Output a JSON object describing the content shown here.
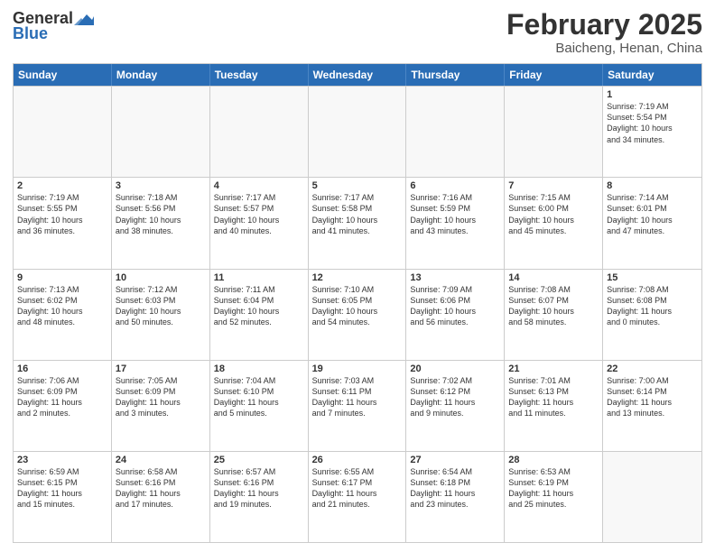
{
  "header": {
    "logo_general": "General",
    "logo_blue": "Blue",
    "month": "February 2025",
    "location": "Baicheng, Henan, China"
  },
  "days_of_week": [
    "Sunday",
    "Monday",
    "Tuesday",
    "Wednesday",
    "Thursday",
    "Friday",
    "Saturday"
  ],
  "weeks": [
    [
      {
        "day": "",
        "info": ""
      },
      {
        "day": "",
        "info": ""
      },
      {
        "day": "",
        "info": ""
      },
      {
        "day": "",
        "info": ""
      },
      {
        "day": "",
        "info": ""
      },
      {
        "day": "",
        "info": ""
      },
      {
        "day": "1",
        "info": "Sunrise: 7:19 AM\nSunset: 5:54 PM\nDaylight: 10 hours\nand 34 minutes."
      }
    ],
    [
      {
        "day": "2",
        "info": "Sunrise: 7:19 AM\nSunset: 5:55 PM\nDaylight: 10 hours\nand 36 minutes."
      },
      {
        "day": "3",
        "info": "Sunrise: 7:18 AM\nSunset: 5:56 PM\nDaylight: 10 hours\nand 38 minutes."
      },
      {
        "day": "4",
        "info": "Sunrise: 7:17 AM\nSunset: 5:57 PM\nDaylight: 10 hours\nand 40 minutes."
      },
      {
        "day": "5",
        "info": "Sunrise: 7:17 AM\nSunset: 5:58 PM\nDaylight: 10 hours\nand 41 minutes."
      },
      {
        "day": "6",
        "info": "Sunrise: 7:16 AM\nSunset: 5:59 PM\nDaylight: 10 hours\nand 43 minutes."
      },
      {
        "day": "7",
        "info": "Sunrise: 7:15 AM\nSunset: 6:00 PM\nDaylight: 10 hours\nand 45 minutes."
      },
      {
        "day": "8",
        "info": "Sunrise: 7:14 AM\nSunset: 6:01 PM\nDaylight: 10 hours\nand 47 minutes."
      }
    ],
    [
      {
        "day": "9",
        "info": "Sunrise: 7:13 AM\nSunset: 6:02 PM\nDaylight: 10 hours\nand 48 minutes."
      },
      {
        "day": "10",
        "info": "Sunrise: 7:12 AM\nSunset: 6:03 PM\nDaylight: 10 hours\nand 50 minutes."
      },
      {
        "day": "11",
        "info": "Sunrise: 7:11 AM\nSunset: 6:04 PM\nDaylight: 10 hours\nand 52 minutes."
      },
      {
        "day": "12",
        "info": "Sunrise: 7:10 AM\nSunset: 6:05 PM\nDaylight: 10 hours\nand 54 minutes."
      },
      {
        "day": "13",
        "info": "Sunrise: 7:09 AM\nSunset: 6:06 PM\nDaylight: 10 hours\nand 56 minutes."
      },
      {
        "day": "14",
        "info": "Sunrise: 7:08 AM\nSunset: 6:07 PM\nDaylight: 10 hours\nand 58 minutes."
      },
      {
        "day": "15",
        "info": "Sunrise: 7:08 AM\nSunset: 6:08 PM\nDaylight: 11 hours\nand 0 minutes."
      }
    ],
    [
      {
        "day": "16",
        "info": "Sunrise: 7:06 AM\nSunset: 6:09 PM\nDaylight: 11 hours\nand 2 minutes."
      },
      {
        "day": "17",
        "info": "Sunrise: 7:05 AM\nSunset: 6:09 PM\nDaylight: 11 hours\nand 3 minutes."
      },
      {
        "day": "18",
        "info": "Sunrise: 7:04 AM\nSunset: 6:10 PM\nDaylight: 11 hours\nand 5 minutes."
      },
      {
        "day": "19",
        "info": "Sunrise: 7:03 AM\nSunset: 6:11 PM\nDaylight: 11 hours\nand 7 minutes."
      },
      {
        "day": "20",
        "info": "Sunrise: 7:02 AM\nSunset: 6:12 PM\nDaylight: 11 hours\nand 9 minutes."
      },
      {
        "day": "21",
        "info": "Sunrise: 7:01 AM\nSunset: 6:13 PM\nDaylight: 11 hours\nand 11 minutes."
      },
      {
        "day": "22",
        "info": "Sunrise: 7:00 AM\nSunset: 6:14 PM\nDaylight: 11 hours\nand 13 minutes."
      }
    ],
    [
      {
        "day": "23",
        "info": "Sunrise: 6:59 AM\nSunset: 6:15 PM\nDaylight: 11 hours\nand 15 minutes."
      },
      {
        "day": "24",
        "info": "Sunrise: 6:58 AM\nSunset: 6:16 PM\nDaylight: 11 hours\nand 17 minutes."
      },
      {
        "day": "25",
        "info": "Sunrise: 6:57 AM\nSunset: 6:16 PM\nDaylight: 11 hours\nand 19 minutes."
      },
      {
        "day": "26",
        "info": "Sunrise: 6:55 AM\nSunset: 6:17 PM\nDaylight: 11 hours\nand 21 minutes."
      },
      {
        "day": "27",
        "info": "Sunrise: 6:54 AM\nSunset: 6:18 PM\nDaylight: 11 hours\nand 23 minutes."
      },
      {
        "day": "28",
        "info": "Sunrise: 6:53 AM\nSunset: 6:19 PM\nDaylight: 11 hours\nand 25 minutes."
      },
      {
        "day": "",
        "info": ""
      }
    ]
  ]
}
